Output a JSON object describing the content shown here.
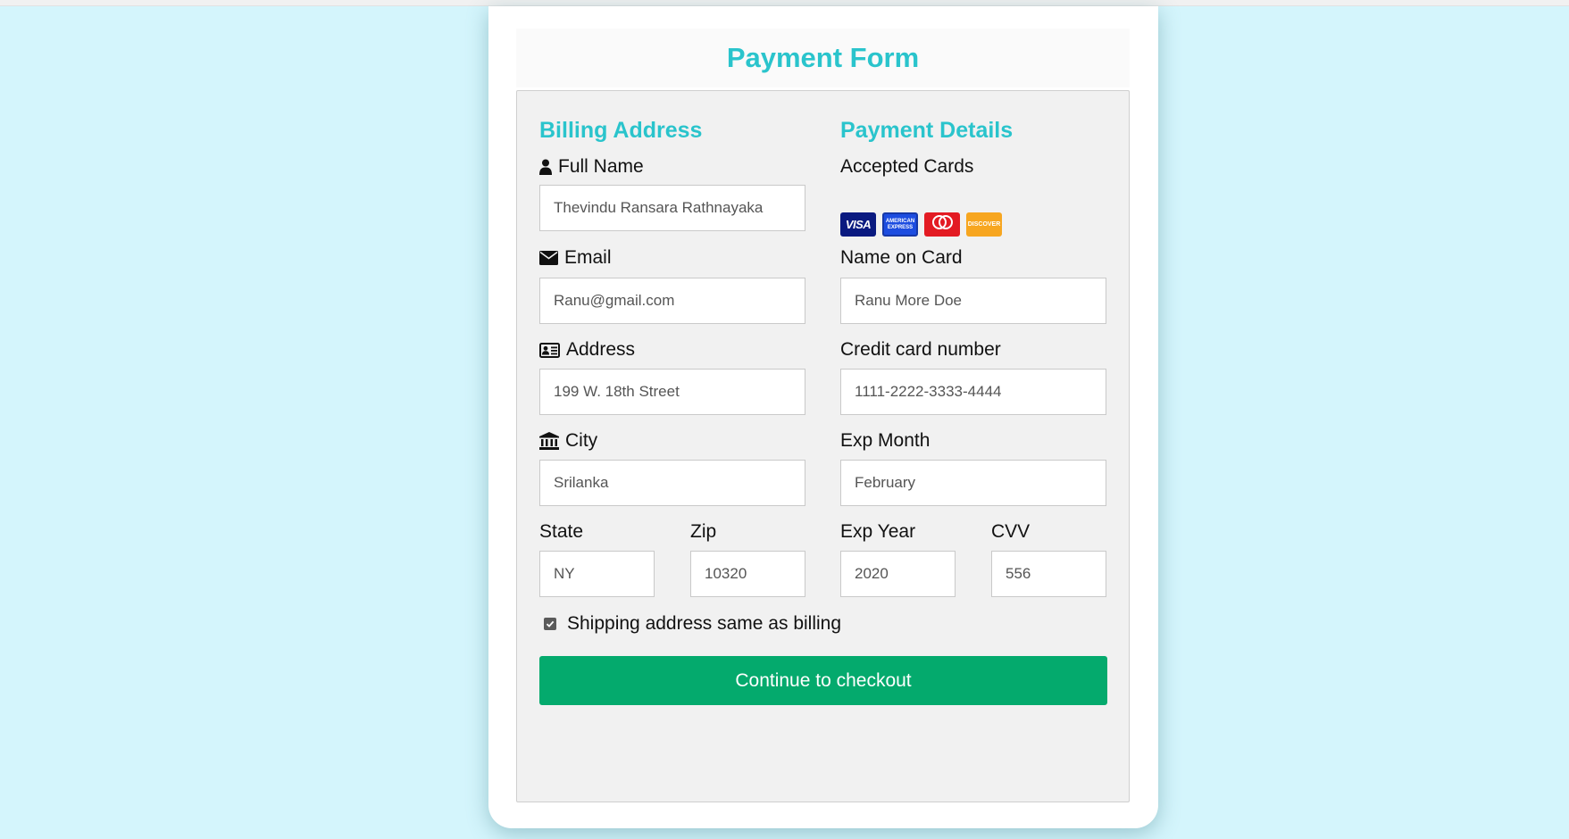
{
  "form": {
    "title": "Payment Form",
    "billing": {
      "heading": "Billing Address",
      "full_name": {
        "label": "Full Name",
        "placeholder": "Thevindu Ransara Rathnayaka"
      },
      "email": {
        "label": "Email",
        "placeholder": "Ranu@gmail.com"
      },
      "address": {
        "label": "Address",
        "placeholder": "199 W. 18th Street"
      },
      "city": {
        "label": "City",
        "placeholder": "Srilanka"
      },
      "state": {
        "label": "State",
        "placeholder": "NY"
      },
      "zip": {
        "label": "Zip",
        "placeholder": "10320"
      }
    },
    "payment": {
      "heading": "Payment Details",
      "accepted_label": "Accepted Cards",
      "cards": [
        "VISA",
        "AMERICAN EXPRESS",
        "mastercard",
        "DISCOVER"
      ],
      "name_on_card": {
        "label": "Name on Card",
        "placeholder": "Ranu More Doe"
      },
      "card_number": {
        "label": "Credit card number",
        "placeholder": "1111-2222-3333-4444"
      },
      "exp_month": {
        "label": "Exp Month",
        "placeholder": "February"
      },
      "exp_year": {
        "label": "Exp Year",
        "placeholder": "2020"
      },
      "cvv": {
        "label": "CVV",
        "placeholder": "556"
      }
    },
    "shipping_same_label": "Shipping address same as billing",
    "shipping_same_checked": true,
    "submit_label": "Continue to checkout"
  },
  "colors": {
    "page_background": "#d4f5fc",
    "accent": "#2ac4cc",
    "button": "#04aa6d"
  },
  "icons": [
    "user-icon",
    "envelope-icon",
    "id-card-icon",
    "institution-icon",
    "visa-card-icon",
    "amex-card-icon",
    "mastercard-icon",
    "discover-card-icon",
    "checkbox-checked-icon"
  ]
}
